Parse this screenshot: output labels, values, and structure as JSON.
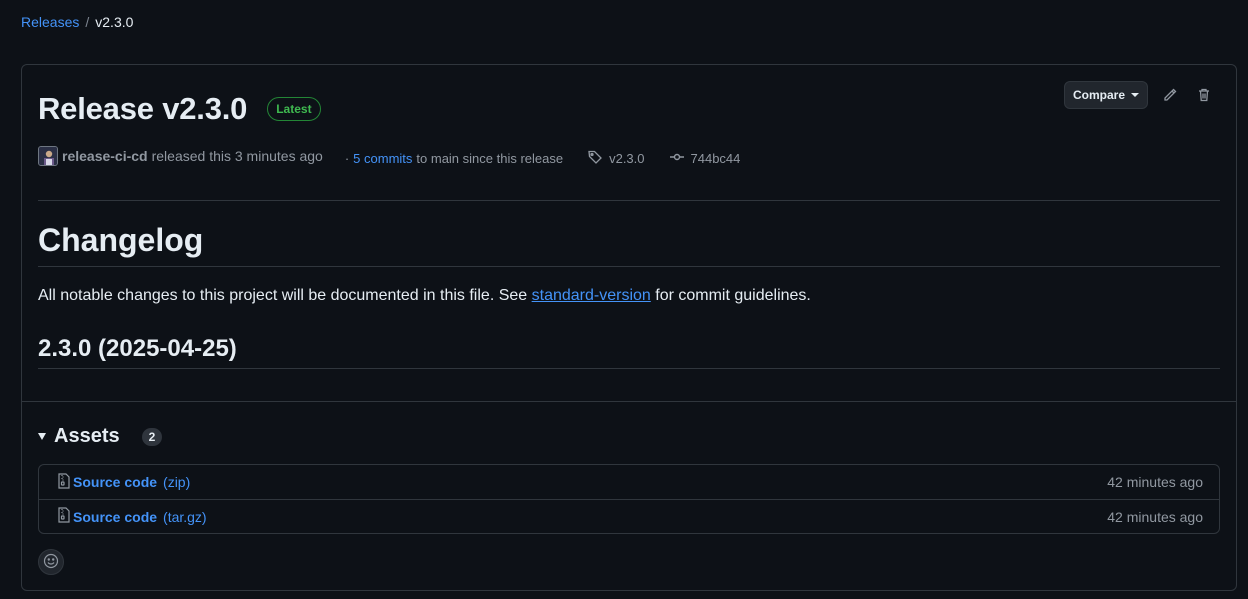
{
  "breadcrumb": {
    "parent": "Releases",
    "separator": "/",
    "current": "v2.3.0"
  },
  "release": {
    "title": "Release v2.3.0",
    "badge": "Latest",
    "author": "release-ci-cd",
    "released_text": "released this 3 minutes ago",
    "commits_prefix": "·",
    "commits_link": "5 commits",
    "commits_suffix": "to main since this release",
    "tag": "v2.3.0",
    "commit_sha": "744bc44"
  },
  "actions": {
    "compare_label": "Compare",
    "edit_icon": "pencil-icon",
    "delete_icon": "trash-icon"
  },
  "body": {
    "heading": "Changelog",
    "intro_before": "All notable changes to this project will be documented in this file. See",
    "intro_link": "standard-version",
    "intro_after": "for commit guidelines.",
    "version_heading": "2.3.0 (2025-04-25)"
  },
  "assets": {
    "title": "Assets",
    "count": "2",
    "items": [
      {
        "name": "Source code",
        "format": "(zip)",
        "time": "42 minutes ago"
      },
      {
        "name": "Source code",
        "format": "(tar.gz)",
        "time": "42 minutes ago"
      }
    ]
  },
  "colors": {
    "background": "#0d1117",
    "link": "#4493f8",
    "latest_badge": "#3fb950",
    "border": "#30363d"
  }
}
